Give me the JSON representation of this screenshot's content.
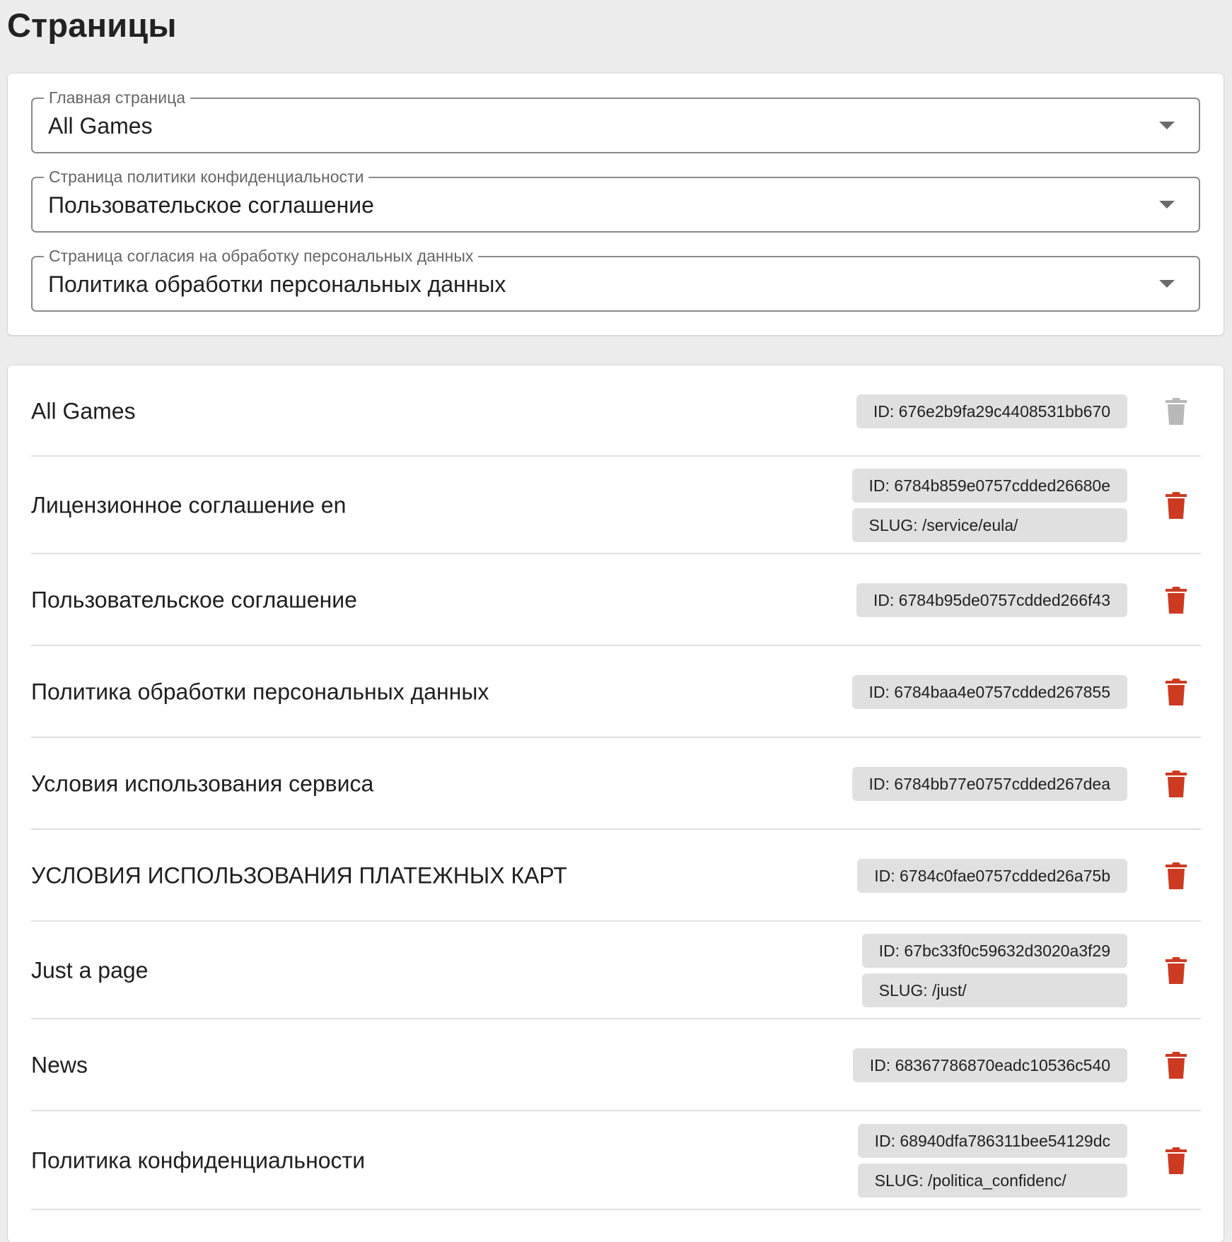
{
  "page_title": "Страницы",
  "settings": [
    {
      "label": "Главная страница",
      "value": "All Games"
    },
    {
      "label": "Страница политики конфиденциальности",
      "value": "Пользовательское соглашение"
    },
    {
      "label": "Страница согласия на обработку персональных данных",
      "value": "Политика обработки персональных данных"
    }
  ],
  "pages": [
    {
      "name": "All Games",
      "id": "ID: 676e2b9fa29c4408531bb670",
      "delete_disabled": true
    },
    {
      "name": "Лицензионное соглашение en",
      "id": "ID: 6784b859e0757cdded26680e",
      "slug": "SLUG: /service/eula/"
    },
    {
      "name": "Пользовательское соглашение",
      "id": "ID: 6784b95de0757cdded266f43"
    },
    {
      "name": "Политика обработки персональных данных",
      "id": "ID: 6784baa4e0757cdded267855"
    },
    {
      "name": "Условия использования сервиса",
      "id": "ID: 6784bb77e0757cdded267dea"
    },
    {
      "name": "УСЛОВИЯ ИСПОЛЬЗОВАНИЯ ПЛАТЕЖНЫХ КАРТ",
      "id": "ID: 6784c0fae0757cdded26a75b"
    },
    {
      "name": "Just a page",
      "id": "ID: 67bc33f0c59632d3020a3f29",
      "slug": "SLUG: /just/"
    },
    {
      "name": "News",
      "id": "ID: 68367786870eadc10536c540"
    },
    {
      "name": "Политика конфиденциальности",
      "id": "ID: 68940dfa786311bee54129dc",
      "slug": "SLUG: /politica_confidenc/"
    }
  ],
  "colors": {
    "delete_active": "#cc3a22",
    "delete_disabled": "#b8b8b8",
    "chip_bg": "#e0e0e0",
    "page_bg": "#ececec"
  },
  "icons": {
    "delete": "trash-icon",
    "dropdown": "arrow-drop-down-icon"
  }
}
